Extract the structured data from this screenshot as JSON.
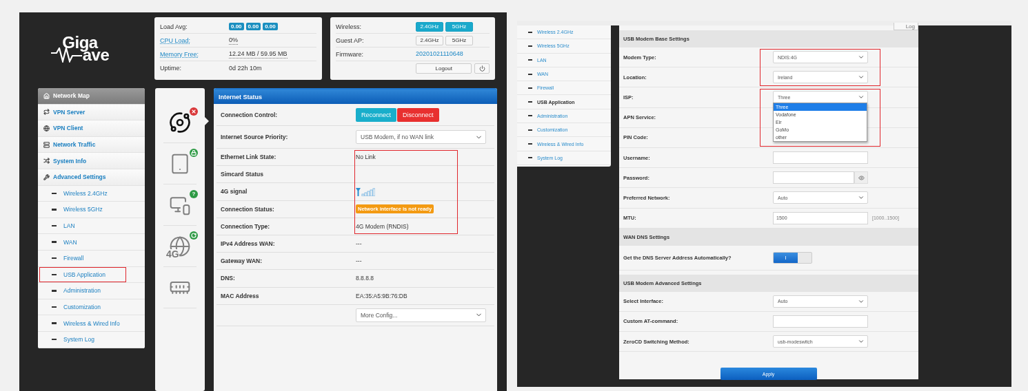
{
  "left_screen": {
    "logo": {
      "top": "Giga",
      "bottom": "ave"
    },
    "system_card": {
      "rows": [
        {
          "kind": "badges",
          "label": "Load Avg:",
          "values": [
            "0.00",
            "0.00",
            "0.00"
          ]
        },
        {
          "kind": "text",
          "label": "CPU Load:",
          "link": true,
          "value": "0%"
        },
        {
          "kind": "text",
          "label": "Memory Free:",
          "link": true,
          "value": "12.24 MB / 59.95 MB"
        },
        {
          "kind": "text",
          "label": "Uptime:",
          "link": false,
          "value": "0d 22h 10m"
        }
      ]
    },
    "network_card": {
      "rows": [
        {
          "kind": "toggles",
          "label": "Wireless:",
          "buttons": [
            {
              "label": "2.4GHz",
              "selected": true
            },
            {
              "label": "5GHz",
              "selected": true
            }
          ]
        },
        {
          "kind": "toggles",
          "label": "Guest AP:",
          "buttons": [
            {
              "label": "2.4GHz",
              "selected": false
            },
            {
              "label": "5GHz",
              "selected": false
            }
          ]
        },
        {
          "kind": "link",
          "label": "Firmware:",
          "value": "20201021110648"
        }
      ],
      "logout": "Logout"
    },
    "sidebar": [
      {
        "kind": "main",
        "label": "Network Map",
        "selected": true,
        "framed": false
      },
      {
        "kind": "main",
        "label": "VPN Server",
        "selected": false,
        "framed": false
      },
      {
        "kind": "main",
        "label": "VPN Client",
        "selected": false,
        "framed": false
      },
      {
        "kind": "main",
        "label": "Network Traffic",
        "selected": false,
        "framed": false
      },
      {
        "kind": "main",
        "label": "System Info",
        "selected": false,
        "framed": false
      },
      {
        "kind": "main",
        "label": "Advanced Settings",
        "selected": false,
        "framed": false
      },
      {
        "kind": "sub",
        "label": "Wireless 2.4GHz",
        "selected": false,
        "framed": false
      },
      {
        "kind": "sub",
        "label": "Wireless 5GHz",
        "selected": false,
        "framed": false
      },
      {
        "kind": "sub",
        "label": "LAN",
        "selected": false,
        "framed": false
      },
      {
        "kind": "sub",
        "label": "WAN",
        "selected": false,
        "framed": false
      },
      {
        "kind": "sub",
        "label": "Firewall",
        "selected": false,
        "framed": false
      },
      {
        "kind": "sub",
        "label": "USB Application",
        "selected": false,
        "framed": true
      },
      {
        "kind": "sub",
        "label": "Administration",
        "selected": false,
        "framed": false
      },
      {
        "kind": "sub",
        "label": "Customization",
        "selected": false,
        "framed": false
      },
      {
        "kind": "sub",
        "label": "Wireless & Wired Info",
        "selected": false,
        "framed": false
      },
      {
        "kind": "sub",
        "label": "System Log",
        "selected": false,
        "framed": false
      }
    ],
    "status_icons": [
      {
        "selected": true,
        "badge": {
          "kind": "error"
        }
      },
      {
        "selected": false,
        "badge": {
          "kind": "lock"
        }
      },
      {
        "selected": false,
        "badge": {
          "kind": "question",
          "text": "?"
        }
      },
      {
        "selected": false,
        "badge": {
          "kind": "refresh"
        },
        "label": "4G"
      },
      {
        "selected": false
      }
    ],
    "internet_status": {
      "title": "Internet Status",
      "rows": [
        {
          "kind": "buttons",
          "label": "Connection Control:",
          "buttons": [
            {
              "label": "Reconnect",
              "kind": "primary"
            },
            {
              "label": "Disconnect",
              "kind": "danger"
            }
          ]
        },
        {
          "kind": "select",
          "label": "Internet Source Priority:",
          "value": "USB Modem, if no WAN link"
        },
        {
          "kind": "group",
          "framed": true,
          "rows": [
            {
              "kind": "text",
              "label": "Ethernet Link State:",
              "value": "No Link"
            },
            {
              "kind": "text",
              "label": "Simcard Status"
            },
            {
              "kind": "signal",
              "label": "4G signal"
            },
            {
              "kind": "badge",
              "label": "Connection Status:",
              "value": "Network interface is not ready"
            },
            {
              "kind": "text",
              "label": "Connection Type:",
              "value": "4G Modem (RNDIS)"
            }
          ]
        },
        {
          "kind": "text",
          "label": "IPv4 Address WAN:",
          "value": "---"
        },
        {
          "kind": "text",
          "label": "Gateway WAN:",
          "value": "---"
        },
        {
          "kind": "text",
          "label": "DNS:",
          "value": "8.8.8.8"
        },
        {
          "kind": "text",
          "label": "MAC Address",
          "value": "EA:35:A5:9B:76:DB"
        },
        {
          "kind": "select",
          "value": "More Config..."
        }
      ]
    }
  },
  "right_screen": {
    "top_tab": "Log",
    "sidebar": [
      {
        "label": "Wireless 2.4GHz",
        "selected": false
      },
      {
        "label": "Wireless 5GHz",
        "selected": false
      },
      {
        "label": "LAN",
        "selected": false
      },
      {
        "label": "WAN",
        "selected": false
      },
      {
        "label": "Firewall",
        "selected": false
      },
      {
        "label": "USB Application",
        "selected": true
      },
      {
        "label": "Administration",
        "selected": false
      },
      {
        "label": "Customization",
        "selected": false
      },
      {
        "label": "Wireless & Wired Info",
        "selected": false
      },
      {
        "label": "System Log",
        "selected": false
      }
    ],
    "form": {
      "sections": [
        {
          "title": "USB Modem Base Settings",
          "rows": [
            {
              "kind": "group",
              "framed": true,
              "rows": [
                {
                  "kind": "select",
                  "label": "Modem Type:",
                  "value": "NDIS:4G"
                },
                {
                  "kind": "select",
                  "label": "Location:",
                  "value": "Ireland"
                }
              ]
            },
            {
              "kind": "group",
              "framed": true,
              "rows": [
                {
                  "kind": "select",
                  "label": "ISP:",
                  "value": "Three",
                  "open": true,
                  "options": [
                    {
                      "label": "Three",
                      "selected": true
                    },
                    {
                      "label": "Vodafone",
                      "selected": false
                    },
                    {
                      "label": "Eir",
                      "selected": false
                    },
                    {
                      "label": "GoMo",
                      "selected": false
                    },
                    {
                      "label": "other",
                      "selected": false
                    }
                  ]
                },
                {
                  "kind": "covered",
                  "label": "APN Service:"
                },
                {
                  "kind": "covered",
                  "label": "PIN Code:"
                }
              ]
            },
            {
              "kind": "input",
              "label": "Username:"
            },
            {
              "kind": "password",
              "label": "Password:"
            },
            {
              "kind": "select",
              "label": "Preferred Network:",
              "value": "Auto"
            },
            {
              "kind": "input",
              "label": "MTU:",
              "value": "1500",
              "hint": "[1000..1500]"
            }
          ]
        },
        {
          "title": "WAN DNS Settings",
          "rows": [
            {
              "kind": "switch",
              "label": "Get the DNS Server Address Automatically?",
              "on": true,
              "switch_text": "I"
            }
          ]
        },
        {
          "title": "USB Modem Advanced Settings",
          "rows": [
            {
              "kind": "select",
              "label": "Select Interface:",
              "value": "Auto"
            },
            {
              "kind": "input",
              "label": "Custom AT-command:"
            },
            {
              "kind": "select",
              "label": "ZeroCD Switching Method:",
              "value": "usb-modeswitch"
            }
          ]
        }
      ],
      "apply": "Apply"
    }
  }
}
